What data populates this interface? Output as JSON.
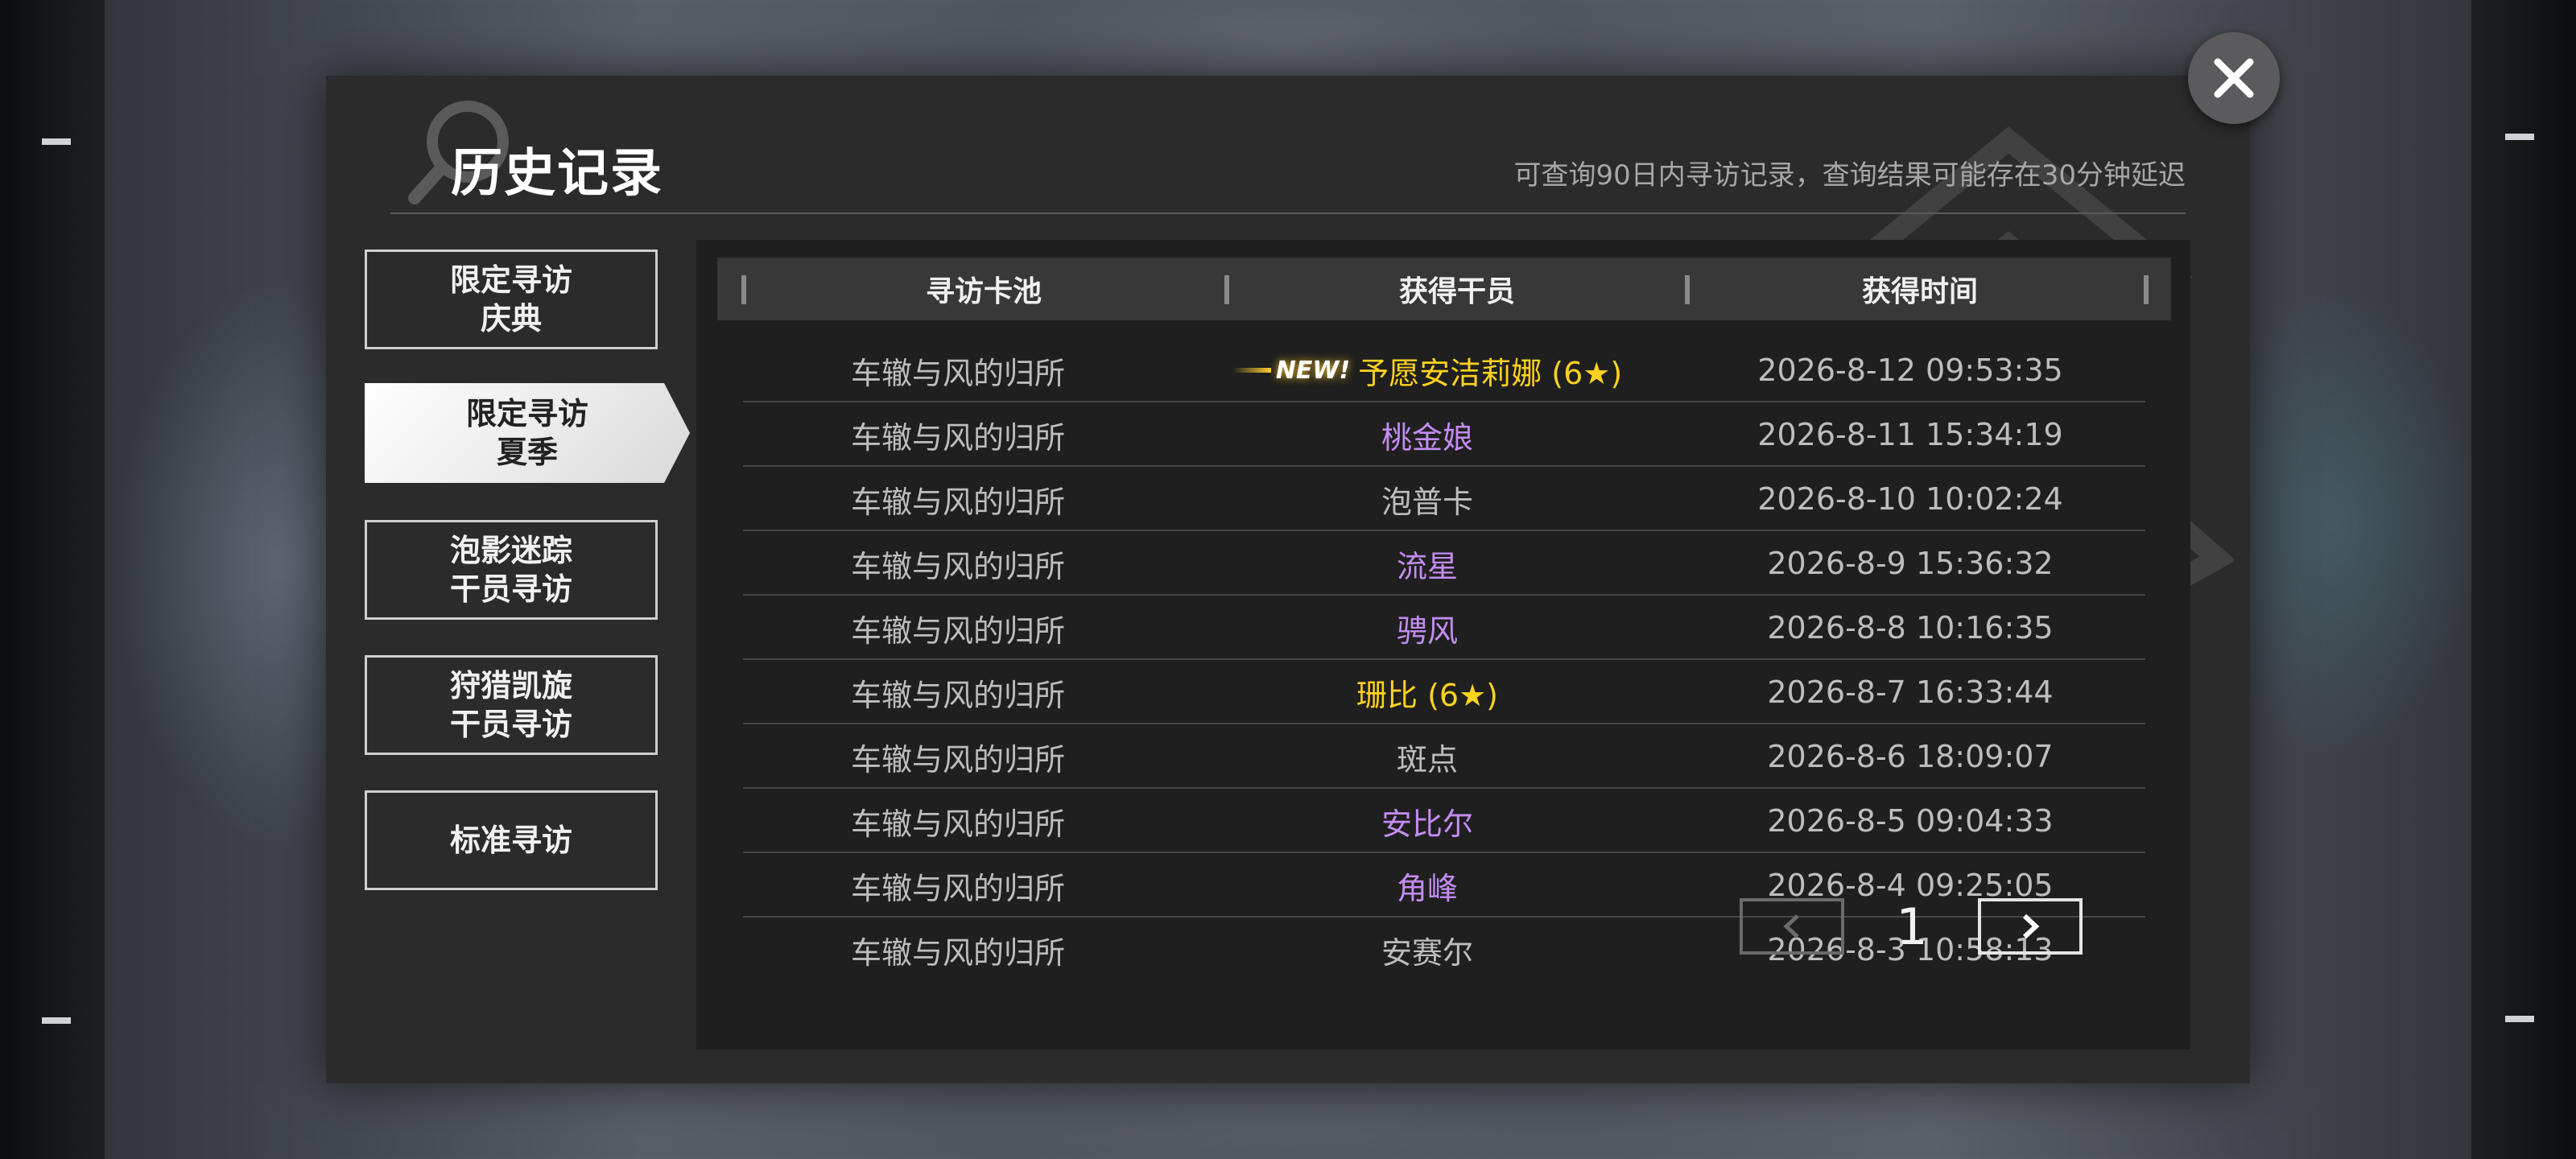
{
  "header": {
    "title": "历史记录",
    "subtitle": "可查询90日内寻访记录，查询结果可能存在30分钟延迟"
  },
  "tabs": [
    {
      "line1": "限定寻访",
      "line2": "庆典",
      "active": false
    },
    {
      "line1": "限定寻访",
      "line2": "夏季",
      "active": true
    },
    {
      "line1": "泡影迷踪",
      "line2": "干员寻访",
      "active": false
    },
    {
      "line1": "狩猎凯旋",
      "line2": "干员寻访",
      "active": false
    },
    {
      "line1": "标准寻访",
      "line2": "",
      "active": false
    }
  ],
  "table": {
    "headers": [
      "寻访卡池",
      "获得干员",
      "获得时间"
    ],
    "rows": [
      {
        "pool": "车辙与风的归所",
        "new_tag": "NEW!",
        "operator": "予愿安洁莉娜 (6★)",
        "rarity": "r6",
        "time": "2026-8-12 09:53:35"
      },
      {
        "pool": "车辙与风的归所",
        "operator": "桃金娘",
        "rarity": "r4",
        "time": "2026-8-11 15:34:19"
      },
      {
        "pool": "车辙与风的归所",
        "operator": "泡普卡",
        "rarity": "r3",
        "time": "2026-8-10 10:02:24"
      },
      {
        "pool": "车辙与风的归所",
        "operator": "流星",
        "rarity": "r4",
        "time": "2026-8-9 15:36:32"
      },
      {
        "pool": "车辙与风的归所",
        "operator": "骋风",
        "rarity": "r4",
        "time": "2026-8-8 10:16:35"
      },
      {
        "pool": "车辙与风的归所",
        "operator": "珊比 (6★)",
        "rarity": "r6",
        "time": "2026-8-7 16:33:44"
      },
      {
        "pool": "车辙与风的归所",
        "operator": "斑点",
        "rarity": "r3",
        "time": "2026-8-6 18:09:07"
      },
      {
        "pool": "车辙与风的归所",
        "operator": "安比尔",
        "rarity": "r4",
        "time": "2026-8-5 09:04:33"
      },
      {
        "pool": "车辙与风的归所",
        "operator": "角峰",
        "rarity": "r4",
        "time": "2026-8-4 09:25:05"
      },
      {
        "pool": "车辙与风的归所",
        "operator": "安赛尔",
        "rarity": "r3",
        "time": "2026-8-3 10:58:13"
      }
    ]
  },
  "pager": {
    "current_page": "1"
  },
  "icons": {
    "close": "close-icon",
    "prev": "chevron-left-icon",
    "next": "chevron-right-icon",
    "deco": "magnifier-icon"
  },
  "colors": {
    "six_star": "#ffd21f",
    "four_star": "#c48cf2",
    "three_star": "#bdbdbd",
    "panel": "#2b2b2c"
  }
}
